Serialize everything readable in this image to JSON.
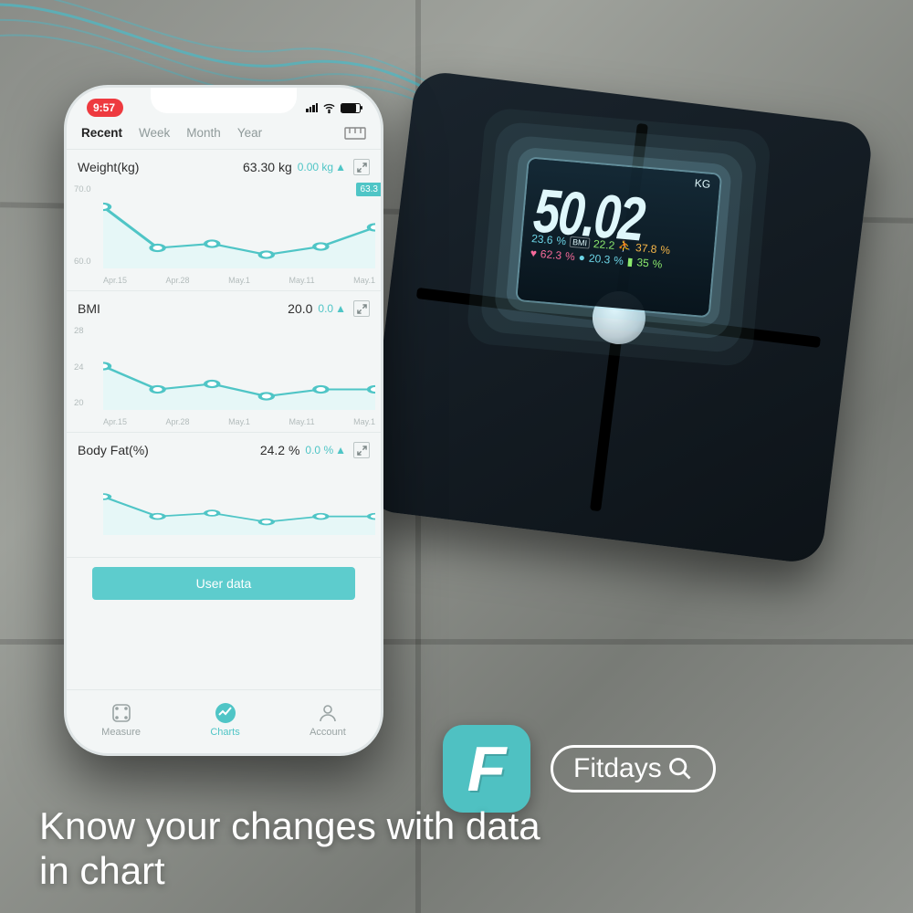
{
  "status_bar": {
    "time": "9:57"
  },
  "tabs": [
    "Recent",
    "Week",
    "Month",
    "Year"
  ],
  "active_tab": "Recent",
  "charts": [
    {
      "metric": "Weight(kg)",
      "value": "63.30 kg",
      "delta": "0.00 kg",
      "badge": "63.3",
      "y_ticks": [
        "70.0",
        "60.0"
      ],
      "x_ticks": [
        "Apr.15",
        "Apr.28",
        "May.1",
        "May.11",
        "May.1"
      ]
    },
    {
      "metric": "BMI",
      "value": "20.0",
      "delta": "0.0",
      "y_ticks": [
        "28",
        "24",
        "20"
      ],
      "x_ticks": [
        "Apr.15",
        "Apr.28",
        "May.1",
        "May.11",
        "May.1"
      ]
    },
    {
      "metric": "Body Fat(%)",
      "value": "24.2 %",
      "delta": "0.0 %",
      "y_ticks": [
        "",
        ""
      ],
      "x_ticks": [
        "",
        "",
        "",
        "",
        ""
      ]
    }
  ],
  "chart_data": [
    {
      "type": "line",
      "title": "Weight(kg)",
      "ylim": [
        55,
        72
      ],
      "ylabel": "kg",
      "x": [
        "Apr.15",
        "Apr.28",
        "May.1",
        "May.11",
        "May.1"
      ],
      "values": [
        67.5,
        60.5,
        61.0,
        59.5,
        60.5,
        63.3
      ]
    },
    {
      "type": "line",
      "title": "BMI",
      "ylim": [
        18,
        28
      ],
      "ylabel": "",
      "x": [
        "Apr.15",
        "Apr.28",
        "May.1",
        "May.11",
        "May.1"
      ],
      "values": [
        22.0,
        20.0,
        20.5,
        19.5,
        20.0,
        20.0
      ]
    },
    {
      "type": "line",
      "title": "Body Fat(%)",
      "ylim": [
        20,
        28
      ],
      "ylabel": "%",
      "x": [
        "Apr.15",
        "Apr.28",
        "May.1",
        "May.11",
        "May.1"
      ],
      "values": [
        26.0,
        24.0,
        24.5,
        23.5,
        24.0,
        24.2
      ]
    }
  ],
  "user_data_btn": "User data",
  "bottom_nav": {
    "measure": "Measure",
    "charts": "Charts",
    "account": "Account"
  },
  "scale_display": {
    "unit": "KG",
    "main": "50.02",
    "row1": {
      "a": "23.6",
      "bmi_label": "BMI",
      "b": "22.2",
      "c": "37.8"
    },
    "row2": {
      "a": "62.3",
      "b": "20.3",
      "c": "35"
    }
  },
  "branding": {
    "app_name": "Fitdays",
    "logo_letter": "F"
  },
  "caption_line1": "Know your changes with data",
  "caption_line2": "in chart",
  "colors": {
    "accent": "#4fc5c6"
  }
}
